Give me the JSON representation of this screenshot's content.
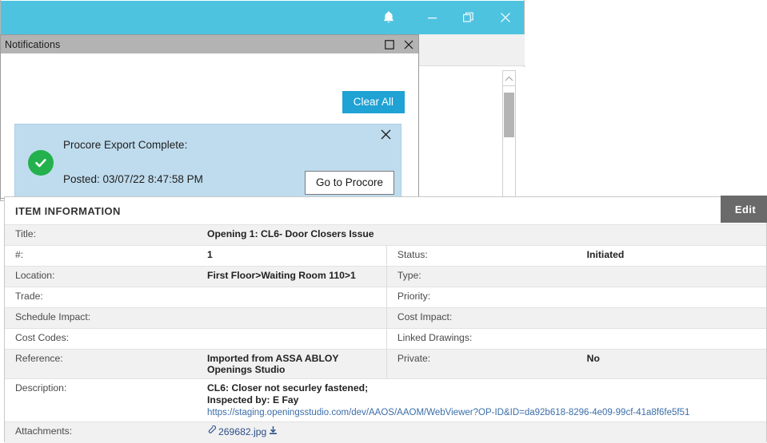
{
  "app_window": {
    "titlebar_color": "#4ec3e0",
    "buttons": [
      {
        "name": "notification-bell",
        "icon": "bell-icon"
      },
      {
        "name": "minimize",
        "icon": "minimize-icon"
      },
      {
        "name": "restore",
        "icon": "restore-icon"
      },
      {
        "name": "close",
        "icon": "close-icon"
      }
    ]
  },
  "notifications": {
    "title": "Notifications",
    "restore_icon": "restore-icon",
    "close_icon": "close-icon",
    "clear_all_label": "Clear All",
    "clear_all_color": "#1fa2d4",
    "card": {
      "background": "#bfdcee",
      "status_icon": "check-circle-icon",
      "status_color": "#22b14c",
      "message": "Procore Export Complete:",
      "posted": "Posted: 03/07/22 8:47:58 PM",
      "action_label": "Go to Procore",
      "dismiss_icon": "close-icon"
    }
  },
  "item_information": {
    "header": "ITEM INFORMATION",
    "edit_label": "Edit",
    "rows": [
      {
        "label": "Title:",
        "value": "Opening 1: CL6- Door Closers Issue",
        "rlabel": "",
        "rvalue": "",
        "full": true,
        "alt": true
      },
      {
        "label": "#:",
        "value": "1",
        "rlabel": "Status:",
        "rvalue": "Initiated",
        "full": false,
        "alt": false
      },
      {
        "label": "Location:",
        "value": "First Floor>Waiting Room 110>1",
        "rlabel": "Type:",
        "rvalue": "",
        "full": false,
        "alt": true
      },
      {
        "label": "Trade:",
        "value": "",
        "rlabel": "Priority:",
        "rvalue": "",
        "full": false,
        "alt": false
      },
      {
        "label": "Schedule Impact:",
        "value": "",
        "rlabel": "Cost Impact:",
        "rvalue": "",
        "full": false,
        "alt": true
      },
      {
        "label": "Cost Codes:",
        "value": "",
        "rlabel": "Linked Drawings:",
        "rvalue": "",
        "full": false,
        "alt": false
      },
      {
        "label": "Reference:",
        "value": "Imported from ASSA ABLOY Openings Studio",
        "rlabel": "Private:",
        "rvalue": "No",
        "full": false,
        "alt": true
      }
    ],
    "description": {
      "label": "Description:",
      "line1": "CL6: Closer not securley fastened;",
      "line2": "Inspected by: E Fay",
      "link": "https://staging.openingsstudio.com/dev/AAOS/AAOM/WebViewer?OP-ID&ID=da92b618-8296-4e09-99cf-41a8f6fe5f51"
    },
    "attachments": {
      "label": "Attachments:",
      "file": "269682.jpg",
      "paperclip_icon": "paperclip-icon",
      "download_icon": "download-icon"
    }
  }
}
